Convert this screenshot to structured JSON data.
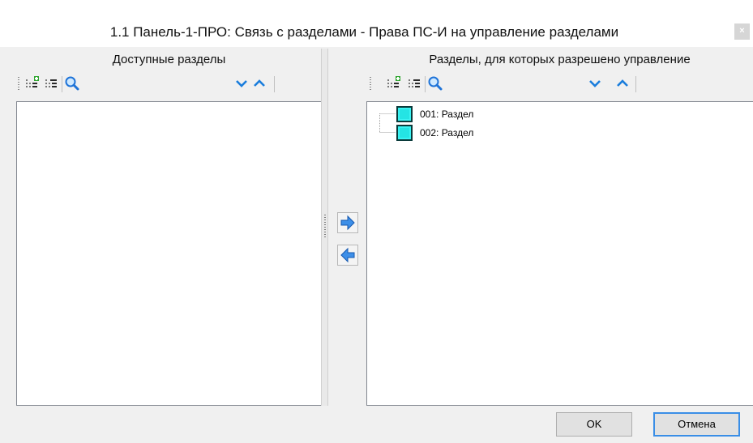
{
  "window": {
    "title": "1.1 Панель-1-ПРО: Связь с разделами - Права ПС-И на управление разделами",
    "close_symbol": "×"
  },
  "left_pane": {
    "header": "Доступные разделы",
    "toolbar": [
      "expand-tree-icon",
      "collapse-tree-icon",
      "search-icon",
      "move-down-icon",
      "move-up-icon"
    ],
    "items": []
  },
  "right_pane": {
    "header": "Разделы, для которых разрешено управление",
    "toolbar": [
      "expand-tree-icon",
      "collapse-tree-icon",
      "search-icon",
      "move-down-icon",
      "move-up-icon"
    ],
    "items": [
      {
        "label": "001: Раздел",
        "icon": "section-icon"
      },
      {
        "label": "002: Раздел",
        "icon": "section-icon"
      }
    ]
  },
  "transfer": {
    "add_icon": "arrow-right-icon",
    "remove_icon": "arrow-left-icon"
  },
  "footer": {
    "ok_label": "OK",
    "cancel_label": "Отмена"
  },
  "colors": {
    "accent": "#0078d7",
    "section_icon_fill": "#24e4e4",
    "arrow_blue": "#1e73d8",
    "chevron_blue": "#1a7ddc"
  }
}
